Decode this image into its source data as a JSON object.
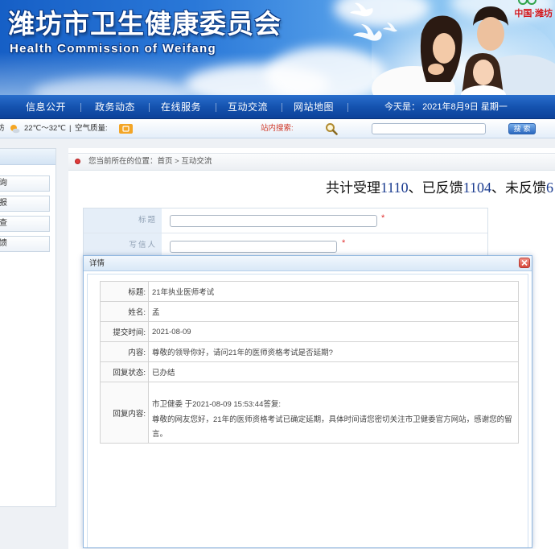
{
  "site": {
    "title_cn": "潍坊市卫生健康委员会",
    "title_en": "Health Commission of Weifang",
    "corner_text": "中国·潍坊"
  },
  "nav": {
    "items": [
      {
        "label": "信息公开"
      },
      {
        "label": "政务动态"
      },
      {
        "label": "在线服务"
      },
      {
        "label": "互动交流"
      },
      {
        "label": "网站地图"
      }
    ],
    "date_prefix": "今天是：",
    "date": "2021年8月9日",
    "weekday": "星期一"
  },
  "infobar": {
    "city": "坊",
    "temperature": "22℃～32℃",
    "separator": "|",
    "air_quality_label": "空气质量:",
    "search_label": "站内搜索:",
    "search_button": "搜索"
  },
  "sidebar": {
    "items": [
      {
        "label": "询"
      },
      {
        "label": "报"
      },
      {
        "label": "查"
      },
      {
        "label": "馈"
      }
    ]
  },
  "breadcrumb": {
    "prefix": "您当前所在的位置：",
    "home": "首页",
    "separator": ">",
    "current": "互动交流"
  },
  "stats": {
    "received_label": "共计受理",
    "received": "1110",
    "sep1": "、",
    "replied_label": "已反馈",
    "replied": "1104",
    "sep2": "、",
    "pending_label": "未反馈",
    "pending": "6"
  },
  "form": {
    "fields": [
      {
        "label": "标题",
        "required": "*"
      },
      {
        "label": "写信人",
        "required": "*"
      }
    ]
  },
  "modal": {
    "title": "详情",
    "rows": [
      {
        "label": "标题:",
        "value": "21年执业医师考试"
      },
      {
        "label": "姓名:",
        "value": "孟"
      },
      {
        "label": "提交时间:",
        "value": "2021-08-09"
      },
      {
        "label": "内容:",
        "value": "尊敬的领导你好，请问21年的医师资格考试是否延期?"
      },
      {
        "label": "回复状态:",
        "value": "已办结"
      },
      {
        "label": "回复内容:",
        "reply_header": "市卫健委 于2021-08-09 15:53:44答复:",
        "reply_body": "尊敬的网友您好，21年的医师资格考试已确定延期，具体时间请您密切关注市卫健委官方网站，感谢您的留言。"
      }
    ]
  },
  "icons": {
    "weather": "sun-cloud-icon",
    "air_quality": "air-quality-icon",
    "search": "search-icon",
    "close": "close-icon",
    "logo": "city-logo-icon"
  },
  "colors": {
    "banner_blue": "#165fc6",
    "nav_blue": "#1553b0",
    "stats_number": "#1a3b8f",
    "required_mark": "#e03030",
    "search_label": "#d03a2a",
    "close_button": "#d6473b",
    "corner_text": "#d4161b"
  }
}
